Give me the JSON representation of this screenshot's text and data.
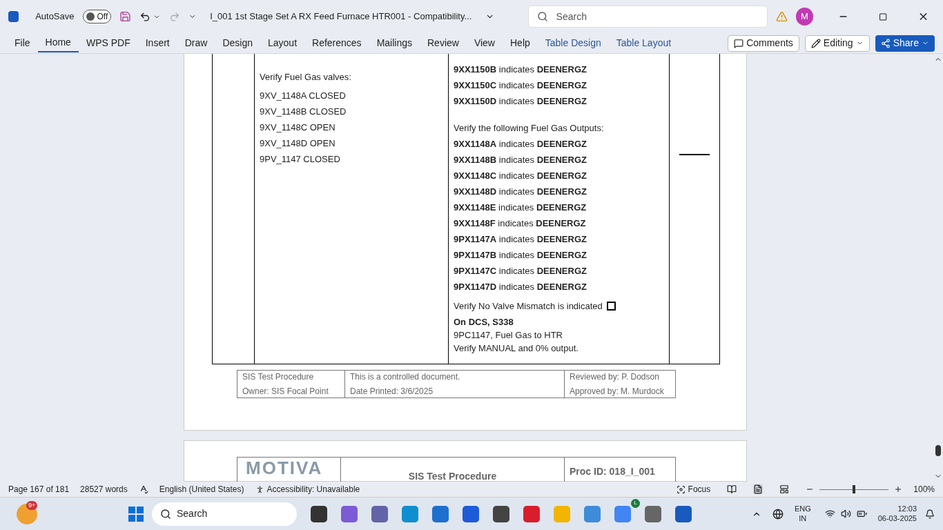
{
  "title_bar": {
    "autosave_label": "AutoSave",
    "autosave_toggle": "Off",
    "autosave_on": false,
    "document_title": "I_001 1st Stage Set A RX Feed Furnace HTR001  -  Compatibility...",
    "search_placeholder": "Search",
    "avatar": "M"
  },
  "ribbon_tabs": [
    {
      "label": "File",
      "selected": false,
      "kind": "plain"
    },
    {
      "label": "Home",
      "selected": true,
      "kind": "plain"
    },
    {
      "label": "WPS PDF",
      "selected": false,
      "kind": "plain"
    },
    {
      "label": "Insert",
      "selected": false,
      "kind": "plain"
    },
    {
      "label": "Draw",
      "selected": false,
      "kind": "plain"
    },
    {
      "label": "Design",
      "selected": false,
      "kind": "plain"
    },
    {
      "label": "Layout",
      "selected": false,
      "kind": "plain"
    },
    {
      "label": "References",
      "selected": false,
      "kind": "plain"
    },
    {
      "label": "Mailings",
      "selected": false,
      "kind": "plain"
    },
    {
      "label": "Review",
      "selected": false,
      "kind": "plain"
    },
    {
      "label": "View",
      "selected": false,
      "kind": "plain"
    },
    {
      "label": "Help",
      "selected": false,
      "kind": "plain"
    },
    {
      "label": "Table Design",
      "selected": false,
      "kind": "contextual"
    },
    {
      "label": "Table Layout",
      "selected": false,
      "kind": "contextual"
    }
  ],
  "ribbon_buttons": {
    "comments": "Comments",
    "editing": "Editing",
    "share": "Share"
  },
  "document": {
    "left_column": [
      "Verify Fuel Gas valves:",
      "9XV_1148A CLOSED",
      "9XV_1148B CLOSED",
      "9XV_1148C OPEN",
      "9XV_1148D OPEN",
      "9PV_1147 CLOSED"
    ],
    "right_column_top": [
      "**9XX1150B** indicates **DEENERGZ**",
      "**9XX1150C** indicates **DEENERGZ**",
      "**9XX1150D** indicates **DEENERGZ**"
    ],
    "outputs_heading": "Verify the following Fuel Gas Outputs:",
    "outputs": [
      "**9XX1148A** indicates **DEENERGZ**",
      "**9XX1148B** indicates **DEENERGZ**",
      "**9XX1148C** indicates **DEENERGZ**",
      "**9XX1148D** indicates **DEENERGZ**",
      "**9XX1148E** indicates **DEENERGZ**",
      "**9XX1148F** indicates **DEENERGZ**",
      "**9PX1147A** indicates **DEENERGZ**",
      "**9PX1147B** indicates **DEENERGZ**",
      "**9PX1147C** indicates **DEENERGZ**",
      "**9PX1147D** indicates **DEENERGZ**"
    ],
    "mismatch": {
      "text": "Verify No Valve Mismatch is indicated",
      "checked": false
    },
    "dcs_heading": "On DCS, S338",
    "dcs_lines": [
      "9PC1147, Fuel Gas to HTR",
      "Verify MANUAL and 0% output."
    ],
    "footer": [
      [
        "SIS Test Procedure",
        "Owner: SIS Focal Point"
      ],
      [
        "This is a controlled document.",
        "Date Printed: 3/6/2025"
      ],
      [
        "Reviewed by: P. Dodson",
        "Approved by: M. Murdock"
      ]
    ],
    "next_page": {
      "logo": "MOTIVA",
      "title": "SIS Test Procedure",
      "proc_id": "Proc ID: 018_I_001"
    }
  },
  "status_bar": {
    "page": "Page 167 of 181",
    "words": "28527 words",
    "language": "English (United States)",
    "accessibility": "Accessibility: Unavailable",
    "focus": "Focus",
    "zoom": "100%",
    "zoom_slider": {
      "level": 0.5
    }
  },
  "taskbar": {
    "badge": "9+",
    "search": "Search",
    "chrome_badge": "L",
    "language": "ENG",
    "region": "IN",
    "time": "12:03",
    "date": "06-03-2025"
  }
}
